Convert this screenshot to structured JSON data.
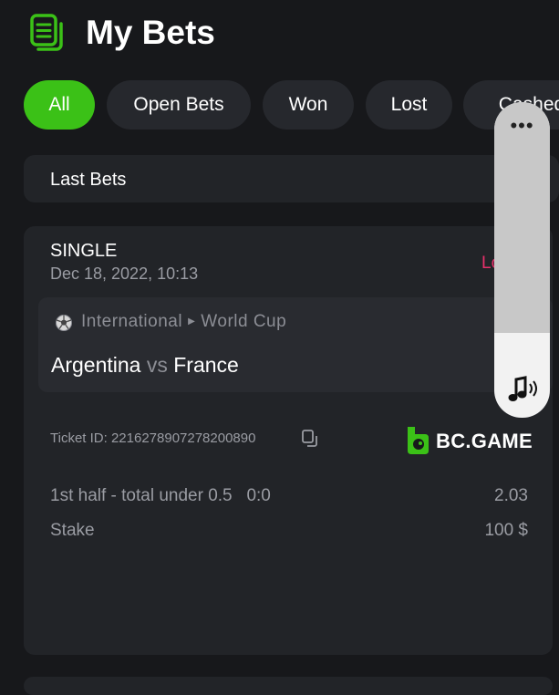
{
  "header": {
    "title": "My Bets",
    "icon": "bets-list-icon"
  },
  "tabs": [
    {
      "label": "All",
      "active": true
    },
    {
      "label": "Open Bets",
      "active": false
    },
    {
      "label": "Won",
      "active": false
    },
    {
      "label": "Lost",
      "active": false
    },
    {
      "label": "Cashed",
      "active": false
    }
  ],
  "section": {
    "label": "Last Bets"
  },
  "bet": {
    "type": "SINGLE",
    "date": "Dec 18, 2022, 10:13",
    "status": "Lost",
    "status_color": "#e8306b",
    "event": {
      "category": "International",
      "league": "World Cup",
      "home": "Argentina",
      "vs": "vs",
      "away": "France"
    },
    "ticket_id": "Ticket ID: 2216278907278200890",
    "brand": "BC.GAME",
    "selection": "1st half - total under 0.5   0:0",
    "odds": "2.03",
    "stake_label": "Stake",
    "stake_value": "100 $"
  },
  "colors": {
    "accent": "#3bc117",
    "background": "#17181b",
    "card": "#222428"
  },
  "overlay": {
    "menu_icon": "more-dots-icon",
    "volume_icon": "volume-icon",
    "volume_level_percent": 27
  }
}
